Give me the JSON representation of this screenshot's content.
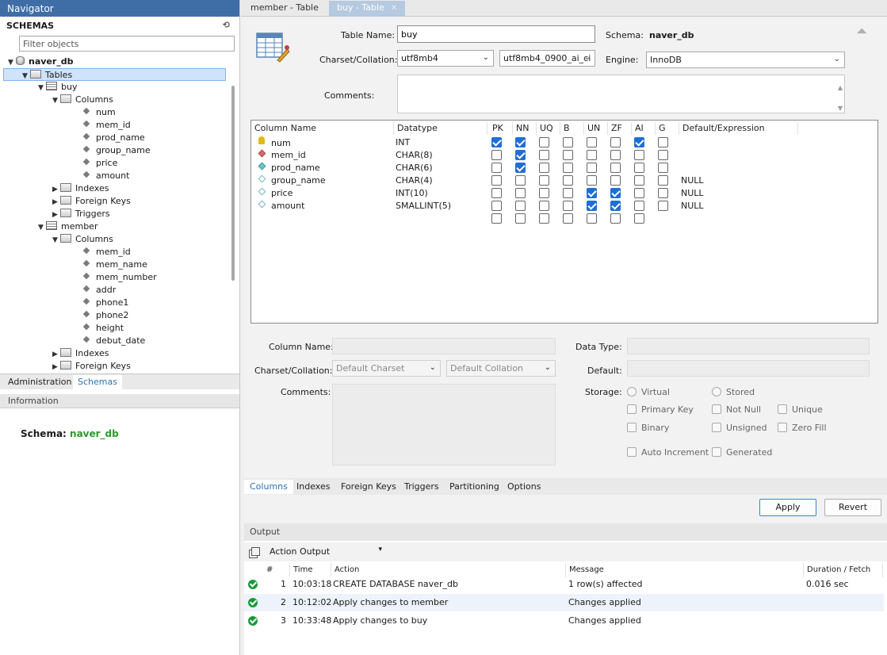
{
  "navigator": {
    "title": "Navigator",
    "schemas_label": "SCHEMAS",
    "filter_placeholder": "Filter objects",
    "tree": [
      {
        "label": "naver_db",
        "depth": 0,
        "arrow": "▼",
        "icon": "db",
        "bold": true
      },
      {
        "label": "Tables",
        "depth": 1,
        "arrow": "▼",
        "icon": "folder",
        "selected": true
      },
      {
        "label": "buy",
        "depth": 2,
        "arrow": "▼",
        "icon": "table"
      },
      {
        "label": "Columns",
        "depth": 3,
        "arrow": "▼",
        "icon": "folder"
      },
      {
        "label": "num",
        "depth": 4,
        "icon": "column"
      },
      {
        "label": "mem_id",
        "depth": 4,
        "icon": "column"
      },
      {
        "label": "prod_name",
        "depth": 4,
        "icon": "column"
      },
      {
        "label": "group_name",
        "depth": 4,
        "icon": "column"
      },
      {
        "label": "price",
        "depth": 4,
        "icon": "column"
      },
      {
        "label": "amount",
        "depth": 4,
        "icon": "column"
      },
      {
        "label": "Indexes",
        "depth": 3,
        "arrow": "▶",
        "icon": "folder"
      },
      {
        "label": "Foreign Keys",
        "depth": 3,
        "arrow": "▶",
        "icon": "folder"
      },
      {
        "label": "Triggers",
        "depth": 3,
        "arrow": "▶",
        "icon": "folder"
      },
      {
        "label": "member",
        "depth": 2,
        "arrow": "▼",
        "icon": "table"
      },
      {
        "label": "Columns",
        "depth": 3,
        "arrow": "▼",
        "icon": "folder"
      },
      {
        "label": "mem_id",
        "depth": 4,
        "icon": "column"
      },
      {
        "label": "mem_name",
        "depth": 4,
        "icon": "column"
      },
      {
        "label": "mem_number",
        "depth": 4,
        "icon": "column"
      },
      {
        "label": "addr",
        "depth": 4,
        "icon": "column"
      },
      {
        "label": "phone1",
        "depth": 4,
        "icon": "column"
      },
      {
        "label": "phone2",
        "depth": 4,
        "icon": "column"
      },
      {
        "label": "height",
        "depth": 4,
        "icon": "column"
      },
      {
        "label": "debut_date",
        "depth": 4,
        "icon": "column"
      },
      {
        "label": "Indexes",
        "depth": 3,
        "arrow": "▶",
        "icon": "folder"
      },
      {
        "label": "Foreign Keys",
        "depth": 3,
        "arrow": "▶",
        "icon": "folder"
      }
    ],
    "tabs": [
      "Administration",
      "Schemas"
    ],
    "active_tab": "Schemas",
    "info_title": "Information",
    "info_schema_label": "Schema:",
    "info_schema_value": "naver_db"
  },
  "doc_tabs": [
    {
      "label": "member - Table",
      "active": false
    },
    {
      "label": "buy - Table",
      "active": true
    }
  ],
  "table_form": {
    "table_name_label": "Table Name:",
    "table_name_value": "buy",
    "schema_label": "Schema:",
    "schema_value": "naver_db",
    "charset_label": "Charset/Collation:",
    "charset_value": "utf8mb4",
    "collation_value": "utf8mb4_0900_ai_ci",
    "engine_label": "Engine:",
    "engine_value": "InnoDB",
    "comments_label": "Comments:",
    "comments_value": ""
  },
  "columns_grid": {
    "headers": [
      "Column Name",
      "Datatype",
      "PK",
      "NN",
      "UQ",
      "B",
      "UN",
      "ZF",
      "AI",
      "G",
      "Default/Expression"
    ],
    "rows": [
      {
        "name": "num",
        "type": "INT",
        "icon": "key",
        "flags": [
          1,
          1,
          0,
          0,
          0,
          0,
          1,
          0
        ],
        "default": ""
      },
      {
        "name": "mem_id",
        "type": "CHAR(8)",
        "icon": "fk",
        "flags": [
          0,
          1,
          0,
          0,
          0,
          0,
          0,
          0
        ],
        "default": ""
      },
      {
        "name": "prod_name",
        "type": "CHAR(6)",
        "icon": "nn",
        "flags": [
          0,
          1,
          0,
          0,
          0,
          0,
          0,
          0
        ],
        "default": ""
      },
      {
        "name": "group_name",
        "type": "CHAR(4)",
        "icon": "col",
        "flags": [
          0,
          0,
          0,
          0,
          0,
          0,
          0,
          0
        ],
        "default": "NULL"
      },
      {
        "name": "price",
        "type": "INT(10)",
        "icon": "col",
        "flags": [
          0,
          0,
          0,
          0,
          1,
          1,
          0,
          0
        ],
        "default": "NULL"
      },
      {
        "name": "amount",
        "type": "SMALLINT(5)",
        "icon": "col",
        "flags": [
          0,
          0,
          0,
          0,
          1,
          1,
          0,
          0
        ],
        "default": "NULL"
      },
      {
        "name": "",
        "type": "",
        "icon": "none",
        "flags": [
          0,
          0,
          0,
          0,
          0,
          0,
          0,
          0
        ],
        "default": ""
      }
    ]
  },
  "column_details": {
    "column_name_label": "Column Name:",
    "data_type_label": "Data Type:",
    "charset_label": "Charset/Collation:",
    "charset_value": "Default Charset",
    "collation_value": "Default Collation",
    "default_label": "Default:",
    "comments_label": "Comments:",
    "storage_label": "Storage:",
    "virtual_label": "Virtual",
    "stored_label": "Stored",
    "primary_key_label": "Primary Key",
    "not_null_label": "Not Null",
    "unique_label": "Unique",
    "binary_label": "Binary",
    "unsigned_label": "Unsigned",
    "zero_fill_label": "Zero Fill",
    "auto_increment_label": "Auto Increment",
    "generated_label": "Generated"
  },
  "editor_tabs": [
    "Columns",
    "Indexes",
    "Foreign Keys",
    "Triggers",
    "Partitioning",
    "Options"
  ],
  "editor_active_tab": "Columns",
  "buttons": {
    "apply": "Apply",
    "revert": "Revert"
  },
  "output": {
    "title": "Output",
    "selector": "Action Output",
    "headers": [
      "#",
      "Time",
      "Action",
      "Message",
      "Duration / Fetch"
    ],
    "rows": [
      {
        "n": "1",
        "time": "10:03:18",
        "action": "CREATE DATABASE naver_db",
        "message": "1 row(s) affected",
        "duration": "0.016 sec"
      },
      {
        "n": "2",
        "time": "10:12:02",
        "action": "Apply changes to member",
        "message": "Changes applied",
        "duration": ""
      },
      {
        "n": "3",
        "time": "10:33:48",
        "action": "Apply changes to buy",
        "message": "Changes applied",
        "duration": ""
      }
    ]
  },
  "colors": {
    "nav_title_bg": "#3f6ea6",
    "accent_blue": "#1f6ed4",
    "success_green": "#1a9a3a",
    "schema_green": "#2a9a2a"
  }
}
